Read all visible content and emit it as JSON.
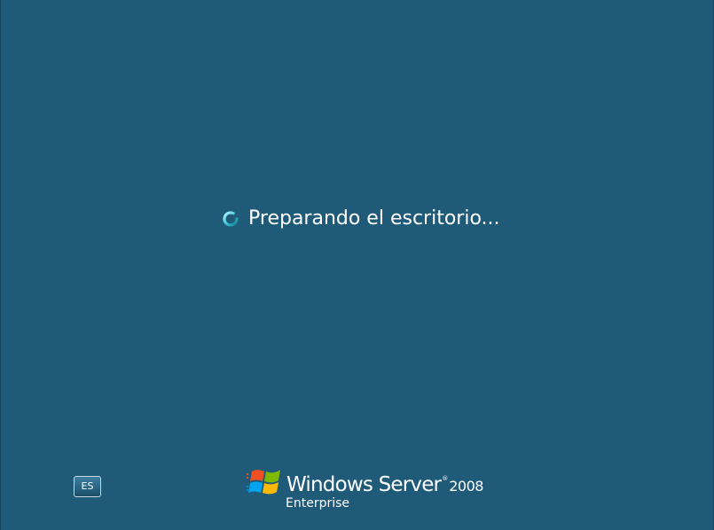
{
  "status": {
    "message": "Preparando el escritorio..."
  },
  "language_button": {
    "label": "ES"
  },
  "branding": {
    "product_name": "Windows Server",
    "trademark": "®",
    "version": "2008",
    "edition": "Enterprise"
  },
  "icons": {
    "spinner": "busy-spinner-icon",
    "logo": "windows-flag-icon"
  },
  "colors": {
    "background": "#1f5b79",
    "text": "#ffffff",
    "spinner_accent": "#7fe7f5"
  }
}
